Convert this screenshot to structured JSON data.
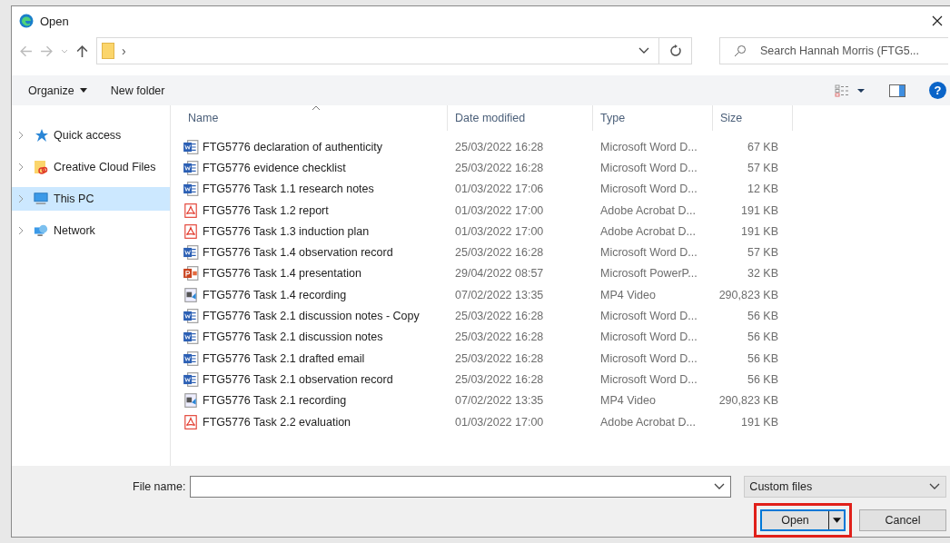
{
  "window": {
    "title": "Open"
  },
  "address": {
    "path_separator": "›"
  },
  "search": {
    "placeholder": "Search Hannah Morris (FTG5..."
  },
  "toolbar": {
    "organize": "Organize",
    "new_folder": "New folder",
    "help": "?"
  },
  "sidebar": {
    "items": [
      {
        "label": "Quick access",
        "kind": "star",
        "selected": false
      },
      {
        "label": "Creative Cloud Files",
        "kind": "cloud",
        "selected": false
      },
      {
        "label": "This PC",
        "kind": "pc",
        "selected": true
      },
      {
        "label": "Network",
        "kind": "network",
        "selected": false
      }
    ]
  },
  "table": {
    "columns": [
      "Name",
      "Date modified",
      "Type",
      "Size"
    ],
    "rows": [
      {
        "name": "FTG5776 declaration of authenticity",
        "date": "25/03/2022 16:28",
        "type": "Microsoft Word D...",
        "size": "67 KB",
        "kind": "word"
      },
      {
        "name": "FTG5776 evidence checklist",
        "date": "25/03/2022 16:28",
        "type": "Microsoft Word D...",
        "size": "57 KB",
        "kind": "word"
      },
      {
        "name": "FTG5776 Task 1.1 research notes",
        "date": "01/03/2022 17:06",
        "type": "Microsoft Word D...",
        "size": "12 KB",
        "kind": "word"
      },
      {
        "name": "FTG5776 Task 1.2 report",
        "date": "01/03/2022 17:00",
        "type": "Adobe Acrobat D...",
        "size": "191 KB",
        "kind": "pdf"
      },
      {
        "name": "FTG5776 Task 1.3 induction plan",
        "date": "01/03/2022 17:00",
        "type": "Adobe Acrobat D...",
        "size": "191 KB",
        "kind": "pdf"
      },
      {
        "name": "FTG5776 Task 1.4 observation record",
        "date": "25/03/2022 16:28",
        "type": "Microsoft Word D...",
        "size": "57 KB",
        "kind": "word"
      },
      {
        "name": "FTG5776 Task 1.4 presentation",
        "date": "29/04/2022 08:57",
        "type": "Microsoft PowerP...",
        "size": "32 KB",
        "kind": "powerpoint"
      },
      {
        "name": "FTG5776 Task 1.4 recording",
        "date": "07/02/2022 13:35",
        "type": "MP4 Video",
        "size": "290,823 KB",
        "kind": "video"
      },
      {
        "name": "FTG5776 Task 2.1 discussion notes - Copy",
        "date": "25/03/2022 16:28",
        "type": "Microsoft Word D...",
        "size": "56 KB",
        "kind": "word"
      },
      {
        "name": "FTG5776 Task 2.1 discussion notes",
        "date": "25/03/2022 16:28",
        "type": "Microsoft Word D...",
        "size": "56 KB",
        "kind": "word"
      },
      {
        "name": "FTG5776 Task 2.1 drafted email",
        "date": "25/03/2022 16:28",
        "type": "Microsoft Word D...",
        "size": "56 KB",
        "kind": "word"
      },
      {
        "name": "FTG5776 Task 2.1 observation record",
        "date": "25/03/2022 16:28",
        "type": "Microsoft Word D...",
        "size": "56 KB",
        "kind": "word"
      },
      {
        "name": "FTG5776 Task 2.1 recording",
        "date": "07/02/2022 13:35",
        "type": "MP4 Video",
        "size": "290,823 KB",
        "kind": "video"
      },
      {
        "name": "FTG5776 Task 2.2 evaluation",
        "date": "01/03/2022 17:00",
        "type": "Adobe Acrobat D...",
        "size": "191 KB",
        "kind": "pdf"
      }
    ]
  },
  "footer": {
    "file_name_label": "File name:",
    "filter": "Custom files",
    "open": "Open",
    "open_highlighted": true,
    "cancel": "Cancel"
  }
}
